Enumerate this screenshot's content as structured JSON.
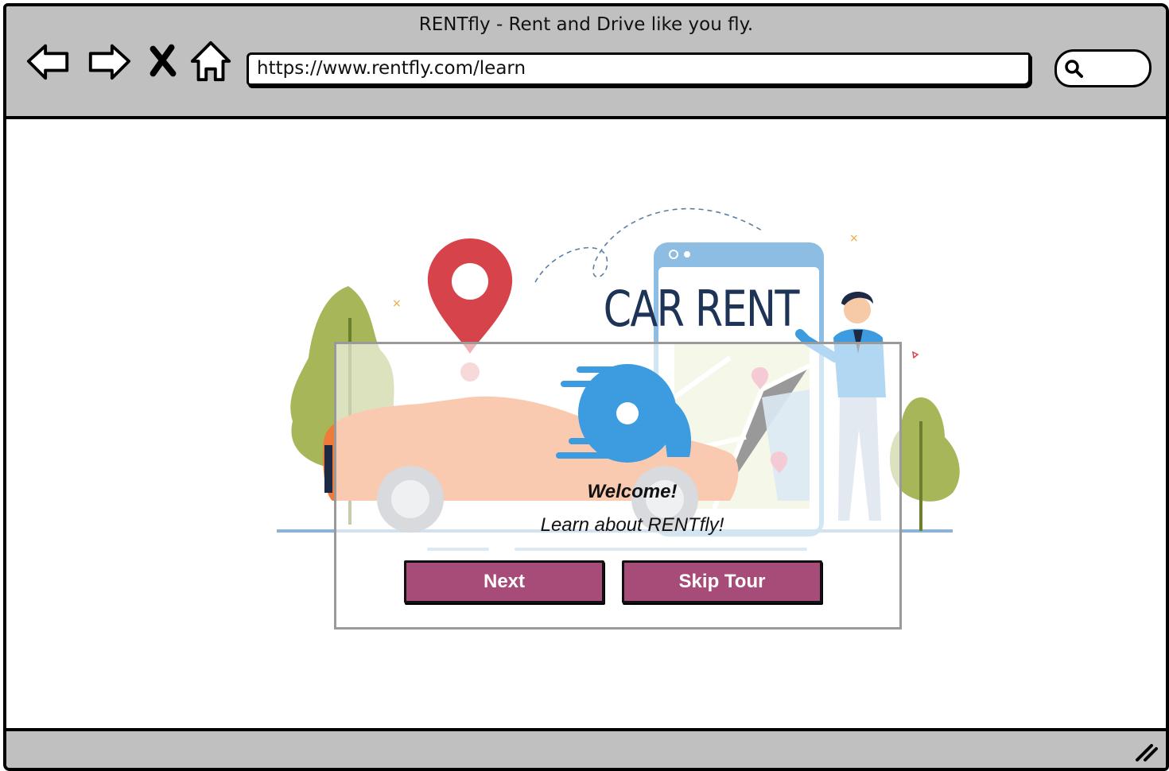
{
  "window": {
    "title": "RENTfly  - Rent and Drive like you fly."
  },
  "toolbar": {
    "back_icon": "arrow-left-icon",
    "forward_icon": "arrow-right-icon",
    "stop_icon": "close-icon",
    "home_icon": "home-icon",
    "search_icon": "search-icon"
  },
  "address_bar": {
    "url": "https://www.rentfly.com/learn"
  },
  "illustration": {
    "sign_text": "CAR RENT"
  },
  "modal": {
    "welcome": "Welcome!",
    "subtitle": "Learn about RENTfly!",
    "next_label": "Next",
    "skip_label": "Skip Tour"
  },
  "colors": {
    "chrome_gray": "#c0c0c0",
    "button_accent": "#a74b78",
    "logo_blue": "#3d9be0",
    "pin_red": "#d7434a",
    "tree_green": "#a8b65a",
    "phone_blue": "#8dbde2",
    "car_orange": "#f07a3a"
  }
}
